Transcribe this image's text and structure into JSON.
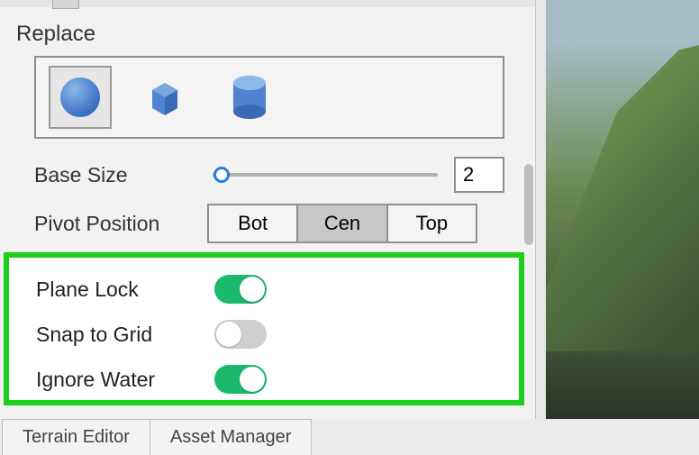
{
  "section": {
    "title": "Replace"
  },
  "shapes": {
    "options": [
      "sphere",
      "cube",
      "cylinder"
    ],
    "selected": "sphere"
  },
  "baseSize": {
    "label": "Base Size",
    "value": "2"
  },
  "pivot": {
    "label": "Pivot Position",
    "buttons": {
      "bot": "Bot",
      "cen": "Cen",
      "top": "Top"
    },
    "active": "cen"
  },
  "toggles": {
    "planeLock": {
      "label": "Plane Lock",
      "on": true
    },
    "snapToGrid": {
      "label": "Snap to Grid",
      "on": false
    },
    "ignoreWater": {
      "label": "Ignore Water",
      "on": true
    }
  },
  "tabs": {
    "terrain": "Terrain Editor",
    "asset": "Asset Manager"
  }
}
